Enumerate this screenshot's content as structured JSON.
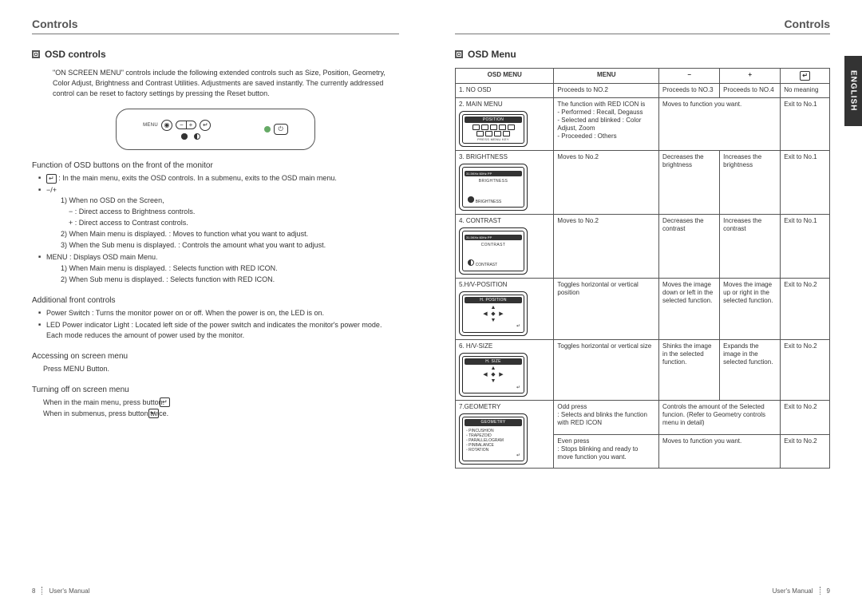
{
  "leftPage": {
    "runningHead": "Controls",
    "sectionTitle": "OSD controls",
    "intro": "\"ON SCREEN MENU\" controls include the following extended controls such as Size, Position, Geometry, Color Adjust, Brightness and Contrast Utilities.  Adjustments are saved instantly. The currently addressed control can be reset to factory settings by pressing the Reset button.",
    "buttonPanel": {
      "menuLabel": "MENU"
    },
    "funcHead": "Function of OSD buttons on the front of the monitor",
    "funcBullets": {
      "enterLine": ": In the main menu, exits the OSD controls. In a submenu, exits to the OSD main menu.",
      "pmHead": "−/+",
      "pm1": "1) When no OSD on the Screen,",
      "pm1a": "− : Direct access to Brightness controls.",
      "pm1b": "+ : Direct access to Contrast controls.",
      "pm2": "2) When Main menu is displayed. : Moves to function what you want to adjust.",
      "pm3": "3) When the Sub menu is displayed. : Controls the amount what you want to adjust.",
      "menuHead": "MENU : Displays OSD main Menu.",
      "menu1": "1) When Main menu is displayed. : Selects function with RED ICON.",
      "menu2": "2) When Sub menu is displayed. : Selects function with RED ICON."
    },
    "addHead": "Additional front controls",
    "addBullets": {
      "b1": "Power Switch : Turns the monitor power on or off. When the power is on, the LED is on.",
      "b2": "LED Power indicator Light : Located left side of the power switch and indicates the monitor's power mode. Each mode reduces the amount of power used by the monitor."
    },
    "accessHead": "Accessing on screen menu",
    "accessText": "Press MENU Button.",
    "offHead": "Turning off on screen menu",
    "offText1": "When in the main menu, press        button.",
    "offText2": "When  in submenus, press        button twice.",
    "footerNum": "8",
    "footerText": "User's Manual"
  },
  "rightPage": {
    "runningHead": "Controls",
    "langTab": "ENGLISH",
    "sectionTitle": "OSD Menu",
    "table": {
      "headers": {
        "c1": "OSD MENU",
        "c2": "MENU",
        "c3": "−",
        "c4": "+",
        "c5": "↵"
      },
      "rows": [
        {
          "osd": "1. NO OSD",
          "menu": "Proceeds to NO.2",
          "minus": "Proceeds to NO.3",
          "plus": "Proceeds to NO.4",
          "exit": "No meaning",
          "fig": null
        },
        {
          "osd": "2. MAIN MENU",
          "menu": "The function with RED ICON is\n- Performed : Recall, Degauss\n- Selected and blinked : Color Adjust, Zoom\n- Proceeded : Others",
          "minus_span": "Moves to function you want.",
          "exit": "Exit to No.1",
          "fig": "main"
        },
        {
          "osd": "3. BRIGHTNESS",
          "menu": "Moves to No.2",
          "minus": "Decreases the brightness",
          "plus": "Increases the brightness",
          "exit": "Exit to No.1",
          "fig": "brightness"
        },
        {
          "osd": "4. CONTRAST",
          "menu": "Moves to No.2",
          "minus": "Decreases the contrast",
          "plus": "Increases the contrast",
          "exit": "Exit to No.1",
          "fig": "contrast"
        },
        {
          "osd": "5.H/V-POSITION",
          "menu": "Toggles horizontal or vertical position",
          "minus": "Moves the image down or left in the selected function.",
          "plus": "Moves the image up or right in the selected function.",
          "exit": "Exit to No.2",
          "fig": "arrows",
          "figTitle": "H. POSITION"
        },
        {
          "osd": "6. H/V-SIZE",
          "menu": "Toggles horizontal or vertical size",
          "minus": "Shinks the image in the selected function.",
          "plus": "Expands the image in the selected function.",
          "exit": "Exit to No.2",
          "fig": "arrows",
          "figTitle": "H. SIZE"
        },
        {
          "osd": "7.GEOMETRY",
          "sub": [
            {
              "menu": "Odd press\n: Selects and blinks the function with RED ICON",
              "minus_span": "Controls the amount of the Selected funcion. (Refer to Geometry controls menu in detail)",
              "exit": "Exit to No.2"
            },
            {
              "menu": "Even press\n: Stops blinking and ready to move function you want.",
              "minus_span": "Moves to function you want.",
              "exit": "Exit to No.2"
            }
          ],
          "fig": "geometry"
        }
      ],
      "geomItems": [
        "PINCUSHION",
        "TRAPEZOID",
        "PARALLELOGRAM",
        "PINBALANCE",
        "ROTATION"
      ],
      "brightLabel": "BRIGHTNESS",
      "contrastLabel": "CONTRAST",
      "mainFigTitle": "POSITION",
      "mainFigFooter": "PRESS MENU KEY",
      "statusBar": "31.5KHz    60Hz    PP",
      "geomTitle": "GEOMETRY"
    },
    "footerText": "User's Manual",
    "footerNum": "9"
  }
}
